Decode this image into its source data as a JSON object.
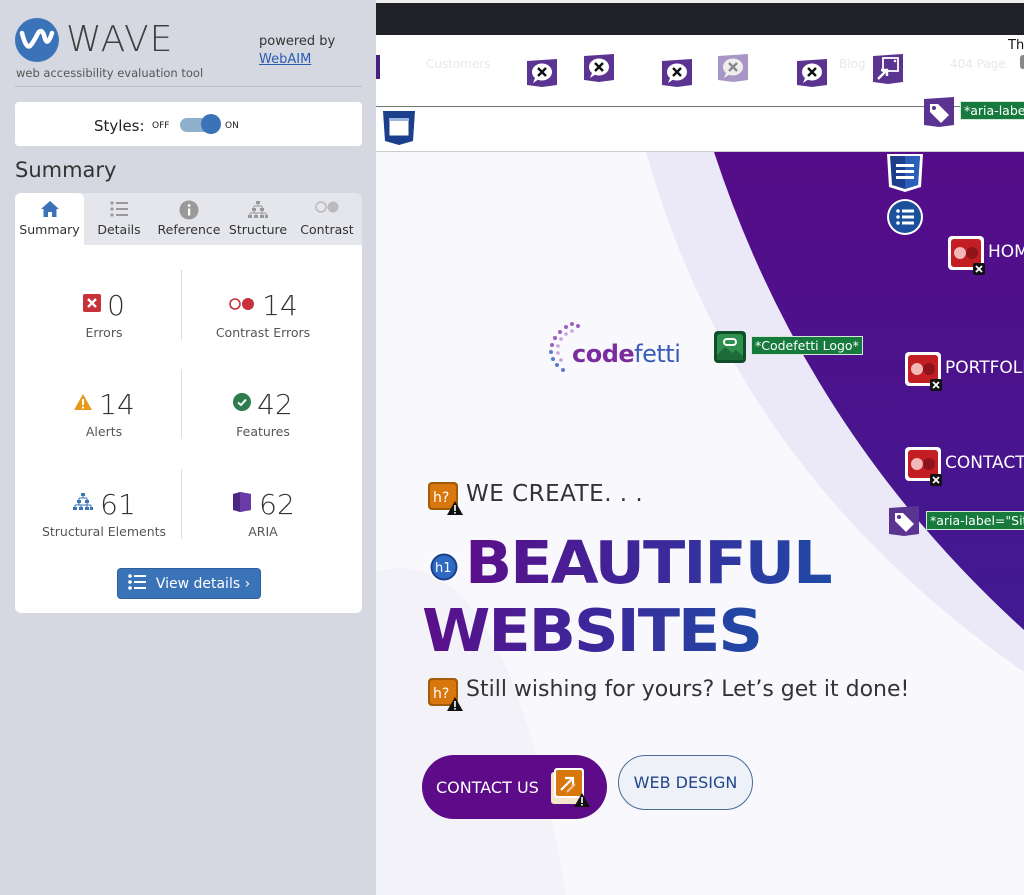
{
  "sidebar": {
    "app_name": "WAVE",
    "app_subtitle": "web accessibility evaluation tool",
    "powered_by": "powered by",
    "powered_by_link": "WebAIM",
    "styles": {
      "label": "Styles:",
      "off_label": "OFF",
      "on_label": "ON",
      "state": "on"
    },
    "section_title": "Summary",
    "tabs": [
      {
        "label": "Summary",
        "icon": "home-icon",
        "active": true
      },
      {
        "label": "Details",
        "icon": "list-icon",
        "active": false
      },
      {
        "label": "Reference",
        "icon": "info-icon",
        "active": false
      },
      {
        "label": "Structure",
        "icon": "hierarchy-icon",
        "active": false
      },
      {
        "label": "Contrast",
        "icon": "contrast-icon",
        "active": false
      }
    ],
    "stats": [
      {
        "label": "Errors",
        "value": "0",
        "icon": "error-icon",
        "color": "#c8303a"
      },
      {
        "label": "Contrast Errors",
        "value": "14",
        "icon": "contrast-error-icon",
        "color": "#c8303a"
      },
      {
        "label": "Alerts",
        "value": "14",
        "icon": "alert-icon",
        "color": "#e69a1c"
      },
      {
        "label": "Features",
        "value": "42",
        "icon": "feature-icon",
        "color": "#2e7d4f"
      },
      {
        "label": "Structural Elements",
        "value": "61",
        "icon": "structure-icon",
        "color": "#3b73b9"
      },
      {
        "label": "ARIA",
        "value": "62",
        "icon": "aria-icon",
        "color": "#5b3391"
      }
    ],
    "view_details_label": "View details ›"
  },
  "page": {
    "nav_links": [
      "Customers",
      "Blog",
      "404 Page"
    ],
    "partial_top_right_text": "Th",
    "aria_label_top": "*aria-labe",
    "logo_brand": "codefetti",
    "logo_brand_bold": "code",
    "logo_brand_light": "fetti",
    "logo_alt_tag": "*Codefetti Logo*",
    "menu_items": [
      "HOM",
      "PORTFOLI",
      "CONTACT"
    ],
    "aria_label_site": "*aria-label=\"Sit",
    "hero_kicker": "WE CREATE. . .",
    "hero_title_line1": "BEAUTIFUL",
    "hero_title_line2": "WEBSITES",
    "hero_tagline": "Still wishing for yours? Let’s get it done!",
    "cta_primary": "CONTACT US",
    "cta_secondary": "WEB DESIGN",
    "badges": {
      "h1": "h1",
      "h_alert": "h?"
    }
  },
  "colors": {
    "wave_blue": "#3b73b9",
    "aria_purple": "#5b3391",
    "brand_purple": "#5d0b88",
    "hero_purple": "#4c108a",
    "alt_green": "#177a3d",
    "error_red": "#c8303a",
    "alert_orange": "#d9770f"
  }
}
